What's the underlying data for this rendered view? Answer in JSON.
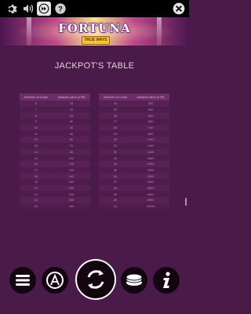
{
  "top_icons": [
    "gear-icon",
    "speaker-icon",
    "fast-forward-icon",
    "help-icon",
    "close-icon"
  ],
  "banner": {
    "title": "FORTUNA",
    "subtitle": "TRUE WAYS"
  },
  "page": {
    "title": "JACKPOT'S TABLE"
  },
  "table": {
    "headers": [
      "Number of Coins",
      "Jackpot value (xTB)"
    ],
    "left": [
      [
        "6",
        "15"
      ],
      [
        "7",
        "20"
      ],
      [
        "8",
        "25"
      ],
      [
        "9",
        "30"
      ],
      [
        "10",
        "40"
      ],
      [
        "11",
        "50"
      ],
      [
        "12",
        "60"
      ],
      [
        "13",
        "70"
      ],
      [
        "14",
        "80"
      ],
      [
        "15",
        "100"
      ],
      [
        "16",
        "120"
      ],
      [
        "17",
        "140"
      ],
      [
        "18",
        "160"
      ],
      [
        "19",
        "180"
      ],
      [
        "20",
        "200"
      ],
      [
        "21",
        "220"
      ],
      [
        "22",
        "250"
      ],
      [
        "23",
        "300"
      ]
    ],
    "right": [
      [
        "24",
        "350"
      ],
      [
        "25",
        "400"
      ],
      [
        "26",
        "500"
      ],
      [
        "27",
        "600"
      ],
      [
        "28",
        "700"
      ],
      [
        "29",
        "800"
      ],
      [
        "30",
        "1000"
      ],
      [
        "31",
        "1200"
      ],
      [
        "32",
        "1400"
      ],
      [
        "33",
        "1600"
      ],
      [
        "34",
        "1800"
      ],
      [
        "35",
        "2000"
      ],
      [
        "36",
        "2500"
      ],
      [
        "37",
        "3000"
      ],
      [
        "38",
        "3500"
      ],
      [
        "39",
        "4000"
      ],
      [
        "40",
        "5000"
      ],
      [
        "41",
        "10000"
      ]
    ]
  },
  "bottom_buttons": [
    "menu-icon",
    "autoplay-icon",
    "spin-icon",
    "coin-bet-icon",
    "info-icon"
  ],
  "colors": {
    "background": "#4a1a48",
    "header_row": "#6d2d69",
    "top_bar": "#000000"
  }
}
